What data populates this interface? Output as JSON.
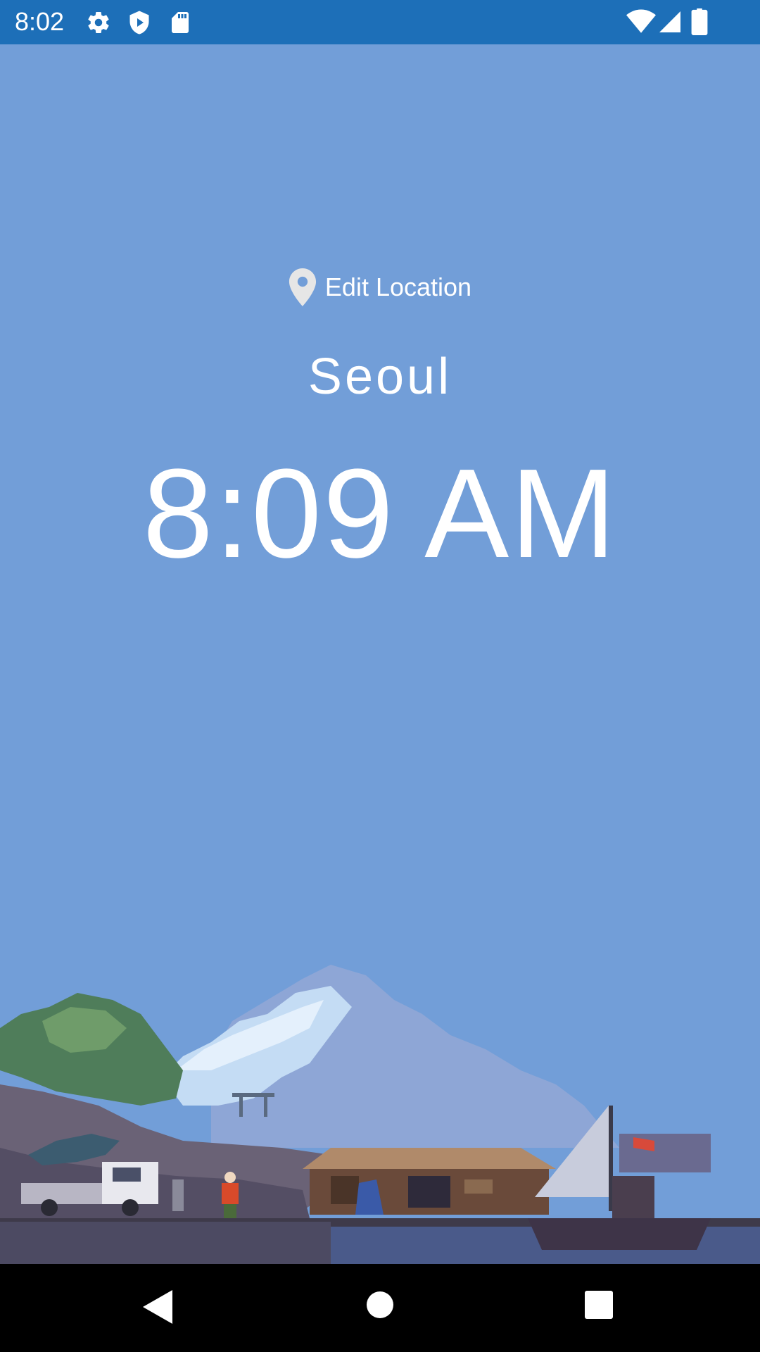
{
  "status_bar": {
    "time": "8:02",
    "left_icons": [
      "gear-icon",
      "shield-play-icon",
      "sd-card-icon"
    ],
    "right_icons": [
      "wifi-icon",
      "cell-signal-icon",
      "battery-icon"
    ],
    "color": "#1d6fb8"
  },
  "main": {
    "edit_location_label": "Edit Location",
    "city": "Seoul",
    "time": "8:09 AM",
    "background_color": "#729ed8"
  },
  "scene": {
    "description_icon": "pixel-art-harbor-scene"
  },
  "nav_bar": {
    "buttons": [
      "back-icon",
      "home-icon",
      "recents-icon"
    ]
  }
}
